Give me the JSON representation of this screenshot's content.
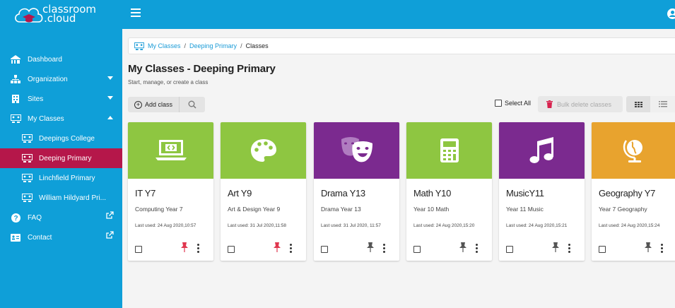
{
  "app": {
    "logo_line1": "classroom",
    "logo_line2": ".cloud"
  },
  "sidebar": {
    "items": [
      {
        "label": "Dashboard"
      },
      {
        "label": "Organization"
      },
      {
        "label": "Sites"
      },
      {
        "label": "My Classes"
      },
      {
        "label": "Deepings College"
      },
      {
        "label": "Deeping Primary"
      },
      {
        "label": "Linchfield Primary"
      },
      {
        "label": "William Hildyard Pri..."
      },
      {
        "label": "FAQ"
      },
      {
        "label": "Contact"
      }
    ]
  },
  "breadcrumb": {
    "item1": "My Classes",
    "item2": "Deeping Primary",
    "current": "Classes"
  },
  "page": {
    "title": "My Classes - Deeping Primary",
    "subtitle": "Start, manage, or create a class"
  },
  "toolbar": {
    "add_label": "Add class",
    "select_all": "Select All",
    "bulk_delete": "Bulk delete classes"
  },
  "cards": [
    {
      "name": "IT Y7",
      "desc": "Computing Year 7",
      "used": "Last used: 24 Aug 2020,10:57",
      "color": "#8ec641",
      "icon": "laptop-icon",
      "pinned": true
    },
    {
      "name": "Art Y9",
      "desc": "Art & Design Year 9",
      "used": "Last used: 31 Jul 2020,11:58",
      "color": "#8ec641",
      "icon": "palette-icon",
      "pinned": true
    },
    {
      "name": "Drama Y13",
      "desc": "Drama Year 13",
      "used": "Last used: 31 Jul 2020, 11:57",
      "color": "#7b2a8f",
      "icon": "theater-masks-icon",
      "pinned": false
    },
    {
      "name": "Math Y10",
      "desc": "Year 10 Math",
      "used": "Last used: 24 Aug 2020,15:20",
      "color": "#8ec641",
      "icon": "calculator-icon",
      "pinned": false
    },
    {
      "name": "MusicY11",
      "desc": "Year 11 Music",
      "used": "Last used: 24 Aug 2020,15:21",
      "color": "#7b2a8f",
      "icon": "music-note-icon",
      "pinned": false
    },
    {
      "name": "Geography Y7",
      "desc": "Year 7 Geography",
      "used": "Last used: 24 Aug 2020,15:24",
      "color": "#e8a32e",
      "icon": "globe-icon",
      "pinned": false
    }
  ]
}
